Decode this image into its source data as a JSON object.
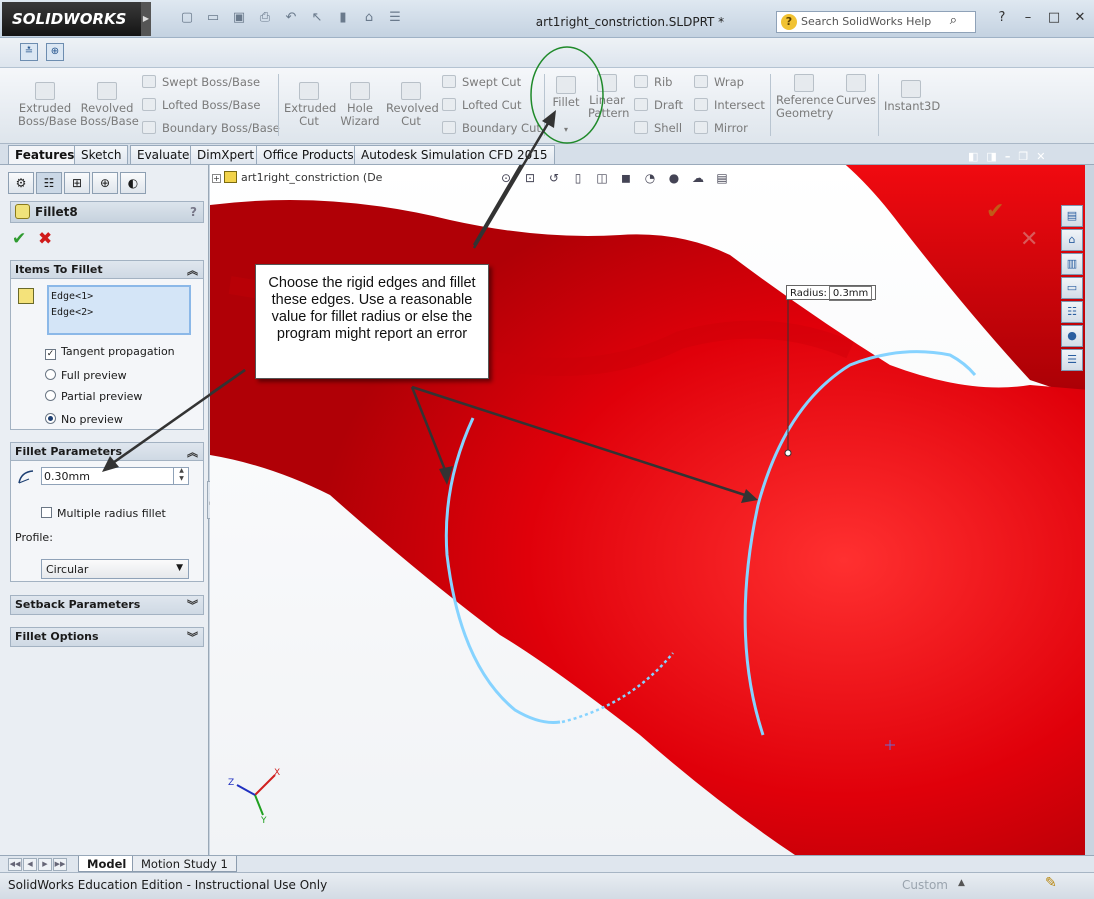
{
  "app": {
    "brand": "SOLIDWORKS",
    "document_title": "art1right_constriction.SLDPRT *",
    "help_search_placeholder": "Search SolidWorks Help"
  },
  "commands": {
    "extruded_boss": "Extruded\nBoss/Base",
    "revolved_boss": "Revolved\nBoss/Base",
    "swept_boss": "Swept Boss/Base",
    "lofted_boss": "Lofted Boss/Base",
    "boundary_boss": "Boundary Boss/Base",
    "extruded_cut": "Extruded\nCut",
    "hole_wizard": "Hole\nWizard",
    "revolved_cut": "Revolved\nCut",
    "swept_cut": "Swept Cut",
    "lofted_cut": "Lofted Cut",
    "boundary_cut": "Boundary Cut",
    "fillet": "Fillet",
    "linear_pattern": "Linear\nPattern",
    "rib": "Rib",
    "draft": "Draft",
    "shell": "Shell",
    "wrap": "Wrap",
    "intersect": "Intersect",
    "mirror": "Mirror",
    "reference_geometry": "Reference\nGeometry",
    "curves": "Curves",
    "instant3d": "Instant3D"
  },
  "tabs": [
    "Features",
    "Sketch",
    "Evaluate",
    "DimXpert",
    "Office Products",
    "Autodesk Simulation CFD 2015"
  ],
  "property_manager": {
    "title": "Fillet8",
    "help": "?",
    "items_section": "Items To Fillet",
    "edges": [
      "Edge<1>",
      "Edge<2>"
    ],
    "tangent_propagation": "Tangent propagation",
    "full_preview": "Full preview",
    "partial_preview": "Partial preview",
    "no_preview": "No preview",
    "params_section": "Fillet Parameters",
    "radius_value": "0.30mm",
    "multiple_radius": "Multiple radius fillet",
    "profile_label": "Profile:",
    "profile_value": "Circular",
    "setback_section": "Setback Parameters",
    "options_section": "Fillet Options"
  },
  "viewport": {
    "tree_node": "art1right_constriction  (De",
    "callout_text": "Choose the rigid edges and fillet these edges. Use a reasonable value for fillet radius or else the program might report an error",
    "radius_label": "Radius:",
    "radius_value": "0.3mm",
    "axis_x": "X",
    "axis_y": "Y",
    "axis_z": "Z"
  },
  "bottom_tabs": [
    "Model",
    "Motion Study 1"
  ],
  "status": {
    "text": "SolidWorks Education Edition - Instructional Use Only",
    "custom": "Custom"
  },
  "colors": {
    "part_red": "#e0000a",
    "edge_highlight": "#7fd0ff",
    "annotation_green": "#1f8a2a"
  }
}
